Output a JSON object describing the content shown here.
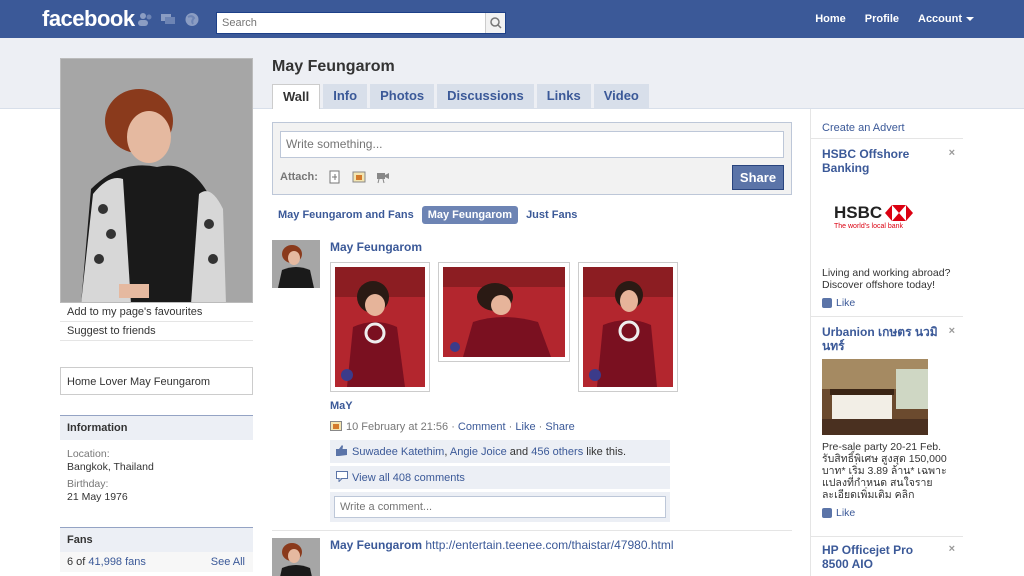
{
  "topbar": {
    "logo": "facebook",
    "search_placeholder": "Search",
    "nav": {
      "home": "Home",
      "profile": "Profile",
      "account": "Account"
    }
  },
  "profile": {
    "name": "May Feungarom",
    "links": {
      "favourites": "Add to my page's favourites",
      "suggest": "Suggest to friends"
    },
    "category": "Home Lover May Feungarom",
    "information": {
      "heading": "Information",
      "location_label": "Location:",
      "location_value": "Bangkok, Thailand",
      "birthday_label": "Birthday:",
      "birthday_value": "21 May 1976"
    },
    "fans": {
      "heading": "Fans",
      "prefix": "6 of ",
      "count": "41,998 fans",
      "see_all": "See All"
    }
  },
  "tabs": [
    "Wall",
    "Info",
    "Photos",
    "Discussions",
    "Links",
    "Video"
  ],
  "composer": {
    "placeholder": "Write something...",
    "attach_label": "Attach:",
    "share_label": "Share"
  },
  "filters": [
    "May Feungarom and Fans",
    "May Feungarom",
    "Just Fans"
  ],
  "story1": {
    "author": "May Feungarom",
    "album_title": "MaY",
    "timestamp": "10 February at 21:56",
    "comment_link": "Comment",
    "like_link": "Like",
    "share_link": "Share",
    "likers": {
      "a": "Suwadee Katethim",
      "b": "Angie Joice",
      "and": "and",
      "others": "456 others",
      "suffix": "like this."
    },
    "view_comments": "View all 408 comments",
    "comment_placeholder": "Write a comment..."
  },
  "story2": {
    "author": "May Feungarom",
    "link": "http://entertain.teenee.com/thaistar/47980.html"
  },
  "ads": {
    "create": "Create an Advert",
    "items": [
      {
        "title": "HSBC Offshore Banking",
        "brand": "HSBC",
        "tagline": "The world's local bank",
        "body": "Living and working abroad? Discover offshore today!",
        "like": "Like"
      },
      {
        "title": "Urbanion เกษตร นวมินทร์",
        "body": "Pre-sale party 20-21 Feb. รับสิทธิ์พิเศษ สูงสุด 150,000 บาท* เริ่ม 3.89 ล้าน* เฉพาะแปลงที่กำหนด สนใจรายละเอียดเพิ่มเติม คลิก",
        "like": "Like"
      },
      {
        "title": "HP Officejet Pro 8500 AIO"
      }
    ],
    "close": "×"
  },
  "colors": {
    "brand": "#3b5998",
    "band": "#edeff4",
    "tab": "#d8dfea",
    "share": "#5b74a8"
  }
}
